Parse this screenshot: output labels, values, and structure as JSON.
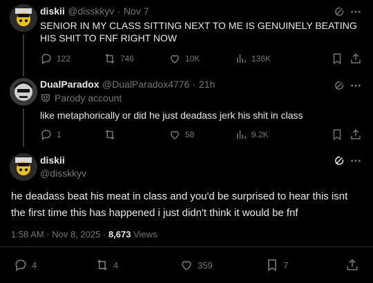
{
  "post1": {
    "display_name": "diskii",
    "handle": "@disskkyv",
    "dot": "·",
    "date": "Nov 7",
    "text": "SENIOR IN MY CLASS SITTING NEXT TO ME IS GENUINELY BEATING HIS SHIT TO FNF RIGHT NOW",
    "replies": "122",
    "reposts": "746",
    "likes": "10K",
    "views": "136K"
  },
  "post2": {
    "display_name": "DualParadox",
    "handle": "@DualParadox4776",
    "dot": "·",
    "date": "21h",
    "label": "Parody account",
    "text": "like metaphorically or did he just deadass jerk his shit in class",
    "replies": "1",
    "reposts": "",
    "likes": "58",
    "views": "9.2K"
  },
  "main": {
    "display_name": "diskii",
    "handle": "@disskkyv",
    "text": "he deadass beat his meat in class and you'd be surprised to hear this isnt the first time this has happened i just didn't think it would be fnf",
    "timestamp": "1:58 AM · Nov 8, 2025",
    "dot": "·",
    "views_count": "8,673",
    "views_label": "Views",
    "replies": "4",
    "reposts": "4",
    "likes": "359",
    "bookmarks": "7"
  },
  "colors": {
    "background": "#000000",
    "text": "#e7e9ea",
    "muted": "#71767b",
    "divider": "#2f3336"
  }
}
